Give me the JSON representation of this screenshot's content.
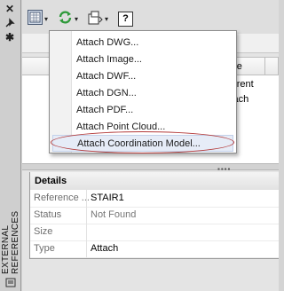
{
  "sidebar": {
    "title": "EXTERNAL REFERENCES",
    "icons": [
      "close-icon",
      "pin-icon",
      "settings-icon"
    ]
  },
  "toolbar": {
    "buttons": [
      "attach-dwg-icon",
      "refresh-icon",
      "change-path-icon",
      "help-icon"
    ],
    "help_label": "?"
  },
  "menu": {
    "items": [
      "Attach DWG...",
      "Attach Image...",
      "Attach DWF...",
      "Attach DGN...",
      "Attach PDF...",
      "Attach Point Cloud...",
      "Attach Coordination Model..."
    ],
    "highlighted_index": 6
  },
  "grid": {
    "columns": [
      "Type"
    ],
    "rows": [
      {
        "type": "Current"
      },
      {
        "type": "Attach"
      }
    ]
  },
  "details": {
    "title": "Details",
    "rows": [
      {
        "label": "Reference ...",
        "value": "STAIR1"
      },
      {
        "label": "Status",
        "value": "Not Found"
      },
      {
        "label": "Size",
        "value": ""
      },
      {
        "label": "Type",
        "value": "Attach"
      }
    ]
  },
  "colors": {
    "menu_highlight": "#e6ecf7",
    "annotation_ellipse": "#b33a3a",
    "refresh_green": "#2e9a3a"
  }
}
